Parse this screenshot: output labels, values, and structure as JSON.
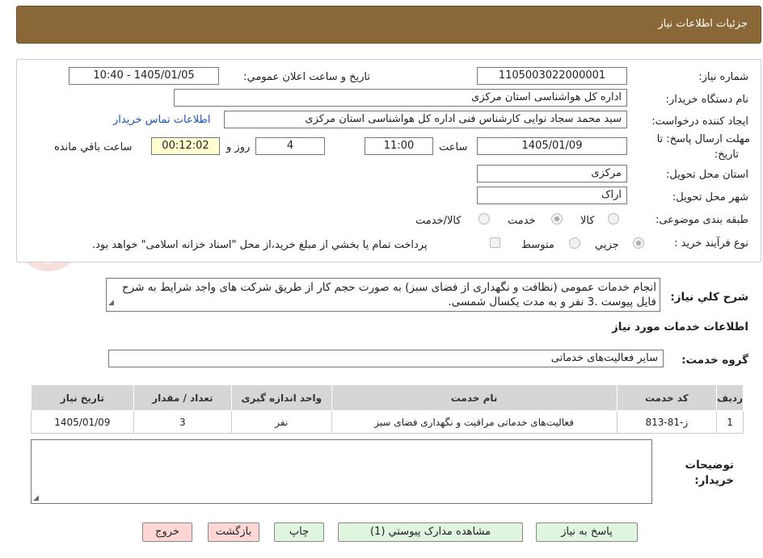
{
  "header": {
    "title": "جزئيات اطلاعات نياز"
  },
  "form": {
    "need_number_label": "شماره نياز:",
    "need_number": "1105003022000001",
    "announce_label": "تاريخ و ساعت اعلان عمومي:",
    "announce_value": "1405/01/05 - 10:40",
    "buyer_org_label": "نام دستگاه خريدار:",
    "buyer_org": "اداره کل هواشناسی استان مرکزی",
    "requester_label": "ايجاد کننده درخواست:",
    "requester": "سید محمد سجاد  نوایی کارشناس  فنی اداره کل هواشناسی استان مرکزی",
    "contact_link": "اطلاعات تماس خريدار",
    "deadline_label_1": "مهلت ارسال پاسخ: تا",
    "deadline_label_2": "تاريخ:",
    "deadline_date": "1405/01/09",
    "time_label": "ساعت",
    "deadline_time": "11:00",
    "days_value": "4",
    "days_label": "روز و",
    "remaining_value": "00:12:02",
    "remaining_label": "ساعت باقي مانده",
    "province_label": "استان محل تحويل:",
    "province": "مرکزی",
    "city_label": "شهر محل تحويل:",
    "city": "اراک",
    "category_label": "طبقه بندی موضوعی:",
    "category_options": [
      "کالا",
      "خدمت",
      "کالا/خدمت"
    ],
    "category_selected": "خدمت",
    "process_label": "نوع فرآيند خريد :",
    "process_options": [
      "جزيي",
      "متوسط"
    ],
    "process_selected": "جزيي",
    "payment_note": "پرداخت تمام يا بخشي از مبلغ خريد،از محل \"اسناد خزانه اسلامی\" خواهد بود."
  },
  "general_desc": {
    "label": "شرح کلي نياز:",
    "text": "انجام خدمات عمومی (نظافت و نگهداری از فضای سبز) به صورت حجم کار از طریق شرکت های واجد شرایط به شرح فایل پیوست .3 نفر و به مدت یکسال شمسی."
  },
  "services": {
    "section_title": "اطلاعات خدمات مورد نياز",
    "group_label": "گروه خدمت:",
    "group_value": "سایر فعالیت‌های خدماتی",
    "columns": [
      "رديف",
      "کد خدمت",
      "نام خدمت",
      "واحد اندازه گيری",
      "تعداد / مقدار",
      "تاريخ نياز"
    ],
    "rows": [
      [
        "1",
        "ز-81-813",
        "فعالیت‌های خدماتی مراقبت و نگهداری فضای سبز",
        "نفر",
        "3",
        "1405/01/09"
      ]
    ]
  },
  "notes": {
    "label_1": "توضيحات",
    "label_2": "خريدار:"
  },
  "buttons": {
    "reply": "پاسخ به نياز",
    "attachments": "مشاهده مدارک پيوستي (1)",
    "print": "چاپ",
    "back": "بازگشت",
    "exit": "خروج"
  },
  "colors": {
    "header_bg": "#8a6737",
    "green_btn": "#dff5df",
    "red_btn": "#ffd6d6",
    "remaining_bg": "#ffffd0",
    "link": "#1a55b5"
  }
}
